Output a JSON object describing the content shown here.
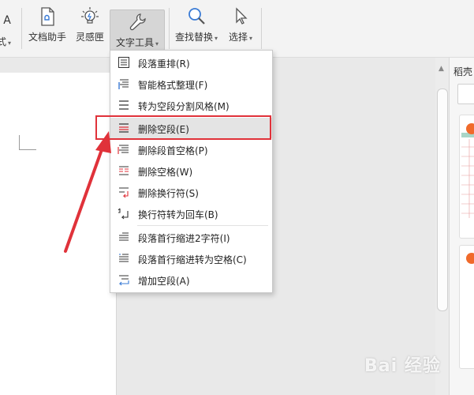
{
  "ribbon": {
    "partial_left_label": "式",
    "partial_left_top": "A",
    "buttons": [
      {
        "label": "文档助手",
        "icon": "document-helper-icon"
      },
      {
        "label": "灵感匣",
        "icon": "lightbulb-icon"
      },
      {
        "label": "文字工具",
        "icon": "wrench-icon",
        "active": true
      },
      {
        "label": "查找替换",
        "icon": "magnifier-icon"
      },
      {
        "label": "选择",
        "icon": "cursor-arrow-icon"
      }
    ]
  },
  "menu": {
    "items": [
      {
        "label": "段落重排(R)",
        "icon": "paragraph-rearrange-icon"
      },
      {
        "label": "智能格式整理(F)",
        "icon": "smart-format-icon"
      },
      {
        "label": "转为空段分割风格(M)",
        "icon": "empty-paragraph-split-icon"
      },
      {
        "label": "删除空段(E)",
        "icon": "delete-empty-paragraph-icon",
        "highlighted": true
      },
      {
        "label": "删除段首空格(P)",
        "icon": "delete-leading-space-icon"
      },
      {
        "label": "删除空格(W)",
        "icon": "delete-space-icon"
      },
      {
        "label": "删除换行符(S)",
        "icon": "delete-line-break-icon"
      },
      {
        "label": "换行符转为回车(B)",
        "icon": "line-break-to-enter-icon"
      },
      {
        "label": "段落首行缩进2字符(I)",
        "icon": "first-line-indent-icon"
      },
      {
        "label": "段落首行缩进转为空格(C)",
        "icon": "indent-to-space-icon"
      },
      {
        "label": "增加空段(A)",
        "icon": "add-empty-paragraph-icon"
      }
    ]
  },
  "right_panel": {
    "title": "稻壳"
  },
  "watermark": "Bai 经验",
  "colors": {
    "highlight_box": "#e0323a",
    "badge": "#f06a2b",
    "menu_hover": "#e4e4e4"
  }
}
